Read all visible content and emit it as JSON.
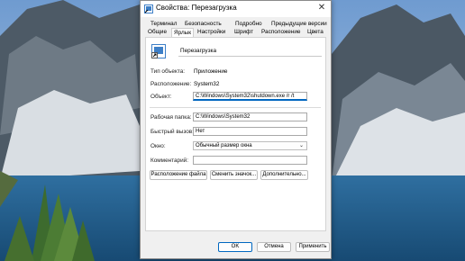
{
  "window": {
    "title": "Свойства: Перезагрузка",
    "close_glyph": "✕"
  },
  "tabs_row1": [
    "Терминал",
    "Безопасность",
    "Подробно",
    "Предыдущие версии"
  ],
  "tabs_row2": [
    "Общие",
    "Ярлык",
    "Настройки",
    "Шрифт",
    "Расположение",
    "Цвета"
  ],
  "active_tab": "Ярлык",
  "shortcut_name": "Перезагрузка",
  "labels": {
    "type": "Тип объекта:",
    "location": "Расположение:",
    "target": "Объект:",
    "start_in": "Рабочая папка:",
    "shortcut_key": "Быстрый вызов:",
    "run": "Окно:",
    "comment": "Комментарий:"
  },
  "values": {
    "type": "Приложение",
    "location": "System32",
    "target": "C:\\Windows\\System32\\shutdown.exe /r /t",
    "start_in": "C:\\Windows\\System32",
    "shortcut_key": "Нет",
    "run": "Обычный размер окна",
    "comment": ""
  },
  "buttons": {
    "open_location": "Расположение файла",
    "change_icon": "Сменить значок...",
    "advanced": "Дополнительно...",
    "ok": "OK",
    "cancel": "Отмена",
    "apply": "Применить"
  },
  "icons": {
    "title": "shortcut-icon",
    "shortcut": "shortcut-icon",
    "dropdown": "chevron-down-icon"
  },
  "colors": {
    "accent": "#0067c0",
    "dialog_bg": "#f0f0f0"
  }
}
